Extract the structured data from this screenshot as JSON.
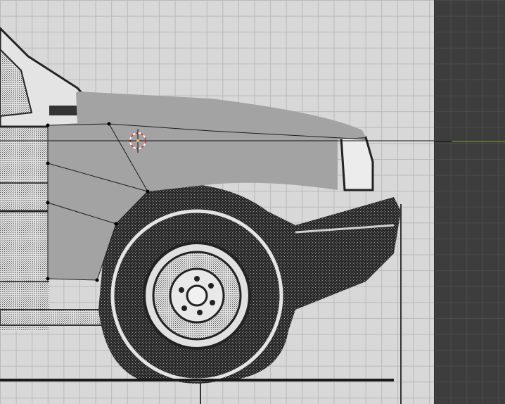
{
  "viewport": {
    "left_background": "#d8d8d8",
    "right_background": "#3d3d3d",
    "grid_color": "#b9b9b9"
  },
  "colors": {
    "mesh_face": "#a3a3a3",
    "mesh_edge": "#1c1c1c",
    "vertex": "#000000",
    "cursor_ring_red": "#d23c3c",
    "cursor_ring_white": "#ffffff",
    "horizon_line": "#111111",
    "green_axis": "#6fa82a",
    "blueprint_dark": "#262626",
    "blueprint_light": "#d8d8d8"
  },
  "icons": {
    "cursor": "3d-cursor-icon"
  }
}
